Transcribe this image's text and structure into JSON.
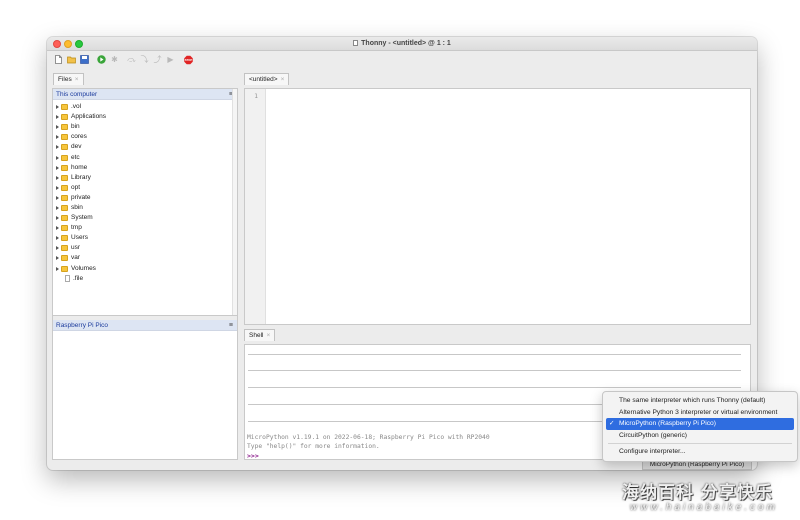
{
  "window": {
    "title": "Thonny  -  <untitled>  @  1 : 1"
  },
  "toolbar": {
    "buttons": [
      {
        "name": "new",
        "icon": "new-file-icon"
      },
      {
        "name": "open",
        "icon": "open-folder-icon"
      },
      {
        "name": "save",
        "icon": "save-icon"
      },
      {
        "name": "run",
        "icon": "run-icon"
      },
      {
        "name": "debug",
        "icon": "debug-icon"
      },
      {
        "name": "step-over",
        "icon": "step-over-icon"
      },
      {
        "name": "step-into",
        "icon": "step-into-icon"
      },
      {
        "name": "step-out",
        "icon": "step-out-icon"
      },
      {
        "name": "resume",
        "icon": "resume-icon"
      },
      {
        "name": "stop",
        "icon": "stop-icon",
        "label": "STOP"
      }
    ]
  },
  "files": {
    "tab_label": "Files",
    "tab_close": "×",
    "this_computer_label": "This computer",
    "menu_glyph": "≡",
    "items": [
      {
        "name": ".vol",
        "type": "folder"
      },
      {
        "name": "Applications",
        "type": "folder"
      },
      {
        "name": "bin",
        "type": "folder"
      },
      {
        "name": "cores",
        "type": "folder"
      },
      {
        "name": "dev",
        "type": "folder"
      },
      {
        "name": "etc",
        "type": "folder"
      },
      {
        "name": "home",
        "type": "folder"
      },
      {
        "name": "Library",
        "type": "folder"
      },
      {
        "name": "opt",
        "type": "folder"
      },
      {
        "name": "private",
        "type": "folder"
      },
      {
        "name": "sbin",
        "type": "folder"
      },
      {
        "name": "System",
        "type": "folder"
      },
      {
        "name": "tmp",
        "type": "folder"
      },
      {
        "name": "Users",
        "type": "folder"
      },
      {
        "name": "usr",
        "type": "folder"
      },
      {
        "name": "var",
        "type": "folder"
      },
      {
        "name": "Volumes",
        "type": "folder"
      },
      {
        "name": ".file",
        "type": "file"
      }
    ],
    "device_label": "Raspberry Pi Pico"
  },
  "editor": {
    "tab_label": "<untitled>",
    "tab_close": "×",
    "line_number": "1"
  },
  "shell": {
    "tab_label": "Shell",
    "tab_close": "×",
    "banner_line1": "MicroPython v1.19.1 on 2022-06-18; Raspberry Pi Pico with RP2040",
    "banner_line2": "Type \"help()\" for more information.",
    "prompt": ">>>"
  },
  "interpreter_menu": {
    "items": [
      {
        "label": "The same interpreter which runs Thonny (default)",
        "selected": false
      },
      {
        "label": "Alternative Python 3 interpreter or virtual environment",
        "selected": false
      },
      {
        "label": "MicroPython (Raspberry Pi Pico)",
        "selected": true
      },
      {
        "label": "CircuitPython (generic)",
        "selected": false
      }
    ],
    "check_mark": "✓",
    "configure_label": "Configure interpreter..."
  },
  "status": {
    "interpreter_button": "MicroPython (Raspberry Pi Pico)"
  },
  "watermark": {
    "text_cn": "海纳百科 分享快乐",
    "text_en": "www.hainabaike.com"
  },
  "colors": {
    "selection": "#2f6de0",
    "pane_header": "#dde5f3",
    "prompt": "#8b1a8b"
  }
}
